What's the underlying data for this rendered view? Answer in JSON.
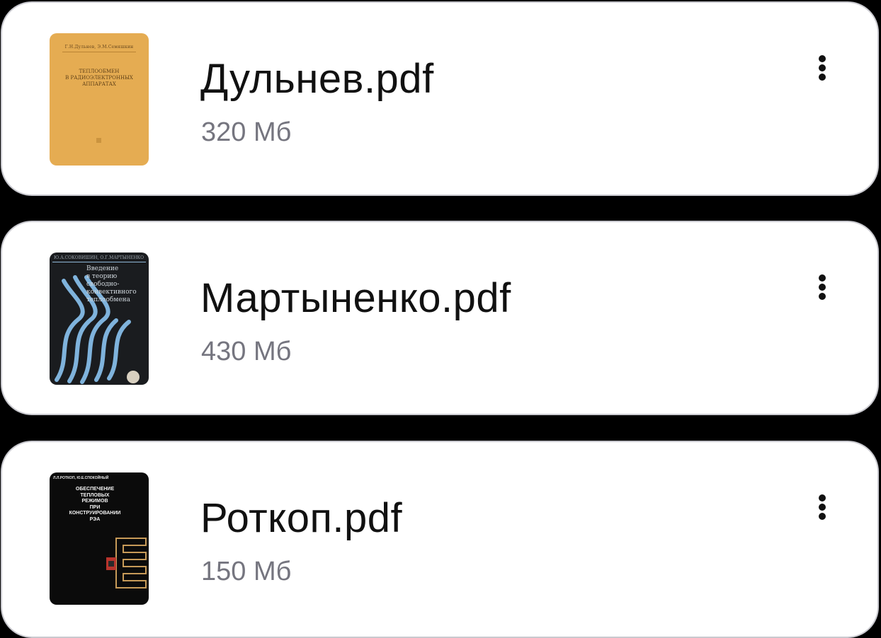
{
  "files": [
    {
      "name": "Дульнев.pdf",
      "size": "320 Мб",
      "cover": {
        "authors": "Г.Н.Дульнев, Э.М.Семяшкин",
        "title": "ТЕПЛООБМЕН\nВ РАДИОЭЛЕКТРОННЫХ\nАППАРАТАХ",
        "color": "#e5ac52"
      }
    },
    {
      "name": "Мартыненко.pdf",
      "size": "430 Мб",
      "cover": {
        "authors": "Ю.А.СОКОВИШИН, О.Г.МАРТЫНЕНКО",
        "title": "Введение\nв теорию\nсвободно-\nконвективного\nтеплообмена",
        "color": "#1a1c1f"
      }
    },
    {
      "name": "Роткоп.pdf",
      "size": "150 Мб",
      "cover": {
        "authors": "Л.Л.РОТКОП, Ю.Е.СПОКОЙНЫЙ",
        "title": "ОБЕСПЕЧЕНИЕ\nТЕПЛОВЫХ\nРЕЖИМОВ\nПРИ\nКОНСТРУИРОВАНИИ\nРЭА",
        "color": "#0b0b0b"
      }
    }
  ],
  "icons": {
    "more": "more-vertical-icon"
  },
  "colors": {
    "card_background": "#ffffff",
    "card_border": "#c9c9cf",
    "page_background": "#000000",
    "name_text": "#111111",
    "size_text": "#75757f"
  }
}
